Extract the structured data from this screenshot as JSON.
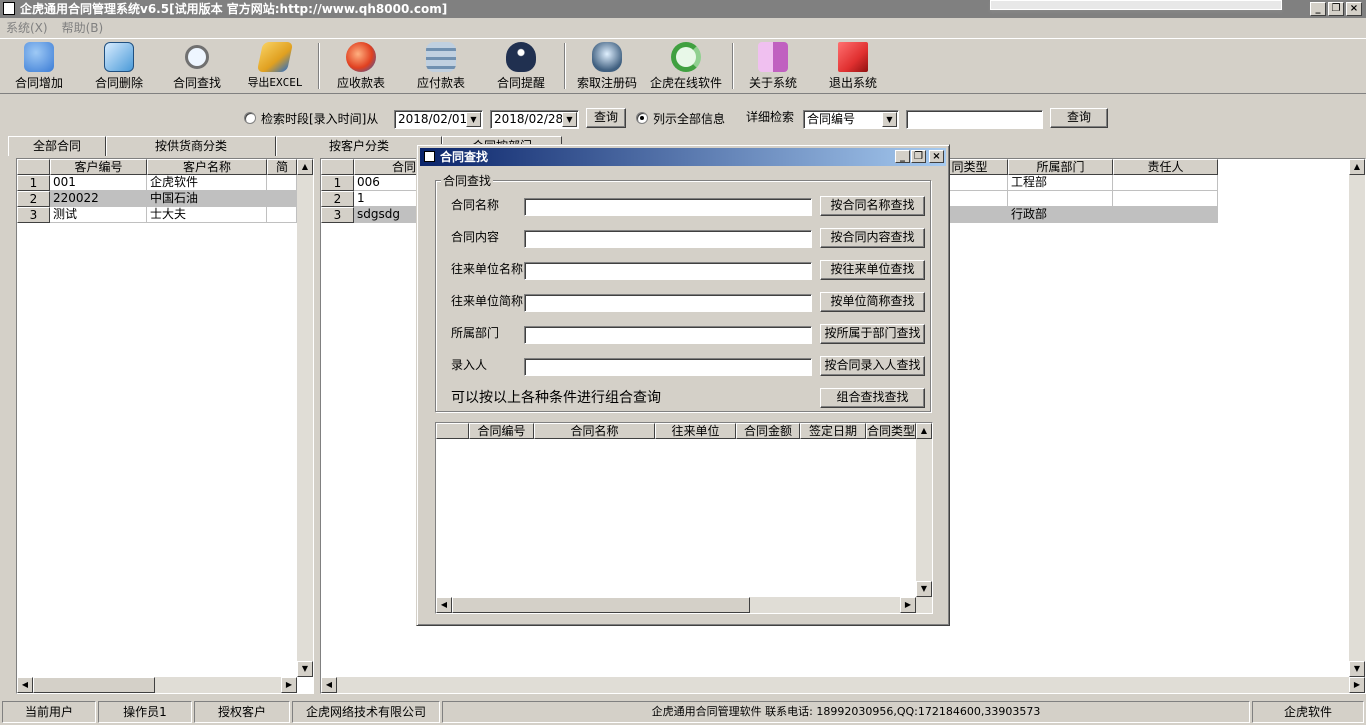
{
  "window": {
    "title": "企虎通用合同管理系统v6.5[试用版本 官方网站:http://www.qh8000.com]",
    "controls": [
      "_",
      "❐",
      "×"
    ]
  },
  "menu": [
    "系统(X)",
    "帮助(B)"
  ],
  "toolbar": [
    {
      "label": "合同增加",
      "icon": "database-add-icon",
      "color": "#3a7bd5"
    },
    {
      "label": "合同删除",
      "icon": "document-delete-icon",
      "color": "#4a9ad8"
    },
    {
      "label": "合同查找",
      "icon": "magnifier-icon",
      "color": "#c8c8c8"
    },
    {
      "label": "导出EXCEL",
      "icon": "export-excel-icon",
      "color": "#e0a020"
    },
    {
      "label": "应收款表",
      "icon": "receivable-icon",
      "color": "#e04020"
    },
    {
      "label": "应付款表",
      "icon": "payable-icon",
      "color": "#7090b0"
    },
    {
      "label": "合同提醒",
      "icon": "reminder-icon",
      "color": "#203050"
    },
    {
      "label": "索取注册码",
      "icon": "register-code-icon",
      "color": "#406080"
    },
    {
      "label": "企虎在线软件",
      "icon": "online-refresh-icon",
      "color": "#40a040"
    },
    {
      "label": "关于系统",
      "icon": "about-finder-icon",
      "color": "#c060c0"
    },
    {
      "label": "退出系统",
      "icon": "exit-cube-icon",
      "color": "#e03030"
    }
  ],
  "search": {
    "period_label": "检索时段[录入时间]从",
    "date_from": "2018/02/01",
    "date_to": "2018/02/28",
    "query_label": "查询",
    "show_all_label": "列示全部信息",
    "detail_label": "详细检索",
    "detail_field": "合同编号",
    "detail_value": "",
    "query2_label": "查询"
  },
  "tabs": [
    "全部合同",
    "按供货商分类",
    "按客户分类",
    "合同按部门"
  ],
  "left_grid": {
    "headers": [
      "客户编号",
      "客户名称",
      "简"
    ],
    "rows": [
      {
        "no": "1",
        "code": "001",
        "name": "企虎软件"
      },
      {
        "no": "2",
        "code": "220022",
        "name": "中国石油"
      },
      {
        "no": "3",
        "code": "测试",
        "name": "士大夫"
      }
    ]
  },
  "right_grid": {
    "headers": [
      "合同",
      "同类型",
      "所属部门",
      "责任人"
    ],
    "rows": [
      {
        "no": "1",
        "code": "006",
        "dept": "工程部"
      },
      {
        "no": "2",
        "code": "1",
        "dept": ""
      },
      {
        "no": "3",
        "code": "sdgsdg",
        "dept": "行政部"
      }
    ]
  },
  "dialog": {
    "title": "合同查找",
    "group_label": "合同查找",
    "fields": [
      {
        "label": "合同名称",
        "button": "按合同名称查找",
        "value": ""
      },
      {
        "label": "合同内容",
        "button": "按合同内容查找",
        "value": ""
      },
      {
        "label": "往来单位名称",
        "button": "按往来单位查找",
        "value": ""
      },
      {
        "label": "往来单位简称",
        "button": "按单位简称查找",
        "value": ""
      },
      {
        "label": "所属部门",
        "button": "按所属于部门查找",
        "value": ""
      },
      {
        "label": "录入人",
        "button": "按合同录入人查找",
        "value": ""
      }
    ],
    "combo_hint": "可以按以上各种条件进行组合查询",
    "combo_button": "组合查找查找",
    "result_headers": [
      "合同编号",
      "合同名称",
      "往来单位",
      "合同金额",
      "签定日期",
      "合同类型"
    ]
  },
  "statusbar": [
    "当前用户",
    "操作员1",
    "授权客户",
    "企虎网络技术有限公司",
    "企虎通用合同管理软件  联系电话: 18992030956,QQ:172184600,33903573",
    "企虎软件"
  ]
}
